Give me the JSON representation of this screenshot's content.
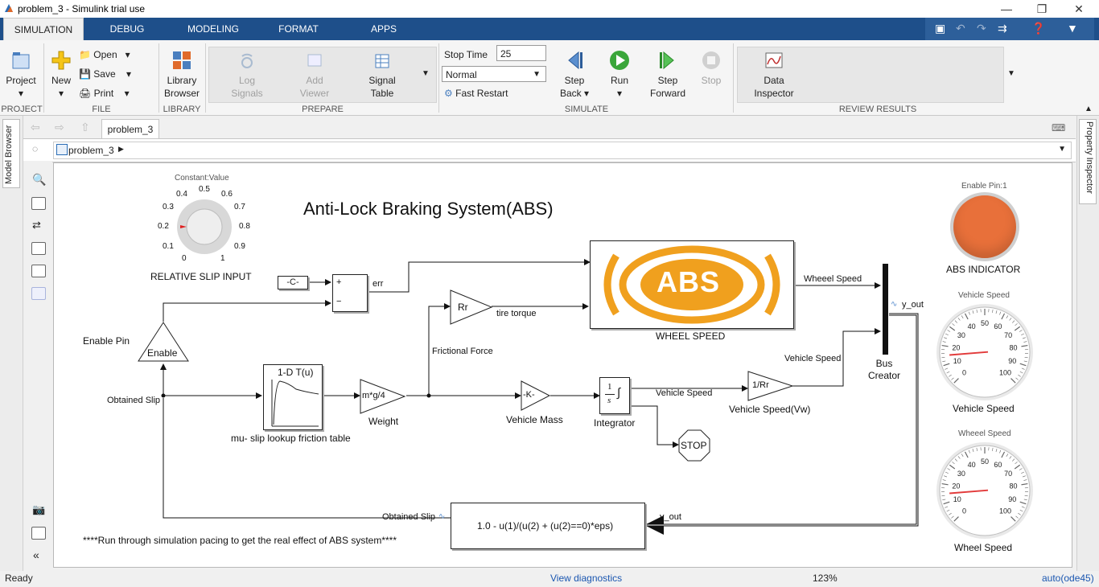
{
  "window": {
    "title": "problem_3 - Simulink trial use"
  },
  "tabs": [
    "SIMULATION",
    "DEBUG",
    "MODELING",
    "FORMAT",
    "APPS"
  ],
  "ribbon": {
    "project": "Project",
    "new": "New",
    "open": "Open",
    "save": "Save",
    "print": "Print",
    "library": "Library",
    "browser": "Browser",
    "log": "Log",
    "signals": "Signals",
    "add": "Add",
    "viewer": "Viewer",
    "signal": "Signal",
    "table": "Table",
    "stop_time_label": "Stop Time",
    "stop_time_value": "25",
    "mode": "Normal",
    "fast_restart": "Fast Restart",
    "step": "Step",
    "back": "Back",
    "run": "Run",
    "forward": "Forward",
    "stop": "Stop",
    "data": "Data",
    "inspector": "Inspector",
    "sections": {
      "project": "PROJECT",
      "file": "FILE",
      "library": "LIBRARY",
      "prepare": "PREPARE",
      "simulate": "SIMULATE",
      "review": "REVIEW RESULTS"
    }
  },
  "editor": {
    "tab": "problem_3",
    "breadcrumb": "problem_3"
  },
  "side": {
    "model_browser": "Model Browser",
    "property_inspector": "Property Inspector"
  },
  "model": {
    "title": "Anti-Lock Braking System(ABS)",
    "knob": {
      "header": "Constant:Value",
      "ticks": [
        "0.4",
        "0.5",
        "0.6",
        "0.3",
        "0.7",
        "0.2",
        "0.8",
        "0.1",
        "0.9",
        "0",
        "1"
      ],
      "label": "RELATIVE SLIP INPUT"
    },
    "const": "-C-",
    "sum_plus": "+",
    "sum_minus": "−",
    "err": "err",
    "enable": "Enable",
    "enable_pin": "Enable Pin",
    "obtained_slip": "Obtained Slip",
    "gain_rr": "Rr",
    "tire_torque": "tire torque",
    "frictional_force": "Frictional Force",
    "abs_text": "ABS",
    "wheel_speed_block": "WHEEL SPEED",
    "wheel_speed_sig": "Wheeel Speed",
    "lookup": "1-D T(u)",
    "lookup_label": "mu- slip lookup friction table",
    "weight_expr": "m*g/4",
    "weight": "Weight",
    "vehicle_mass_expr": "-K-",
    "vehicle_mass": "Vehicle Mass",
    "integ_num": "1",
    "integ_den": "s",
    "integrator": "Integrator",
    "vehicle_speed_sig": "Vehicle Speed",
    "vehicle_speed_sig2": "Vehicle Speed",
    "inv_rr": "1/Rr",
    "vehicle_speed_vw": "Vehicle Speed(Vw)",
    "stop": "STOP",
    "bus_creator": "Bus\nCreator",
    "y_out": "y_out",
    "y_out2": "y_out",
    "fcn": "1.0 - u(1)/(u(2) + (u(2)==0)*eps)",
    "obtained_slip2": "Obtained Slip",
    "note": "****Run through simulation pacing to get the real effect of ABS system****",
    "lamp_header": "Enable Pin:1",
    "lamp_label": "ABS INDICATOR",
    "gauge1": {
      "header": "Vehicle Speed",
      "label": "Vehicle Speed",
      "ticks": [
        "0",
        "10",
        "20",
        "30",
        "40",
        "50",
        "60",
        "70",
        "80",
        "90",
        "100"
      ],
      "value": 0.15
    },
    "gauge2": {
      "header": "Wheeel Speed",
      "label": "Wheel Speed",
      "ticks": [
        "0",
        "10",
        "20",
        "30",
        "40",
        "50",
        "60",
        "70",
        "80",
        "90",
        "100"
      ],
      "value": 0.15
    }
  },
  "status": {
    "ready": "Ready",
    "diagnostics": "View diagnostics",
    "zoom": "123%",
    "solver": "auto(ode45)"
  },
  "colors": {
    "ribbon_tab": "#1e4f8a",
    "abs_orange": "#f0a01e",
    "lamp": "#e8703a",
    "run_green": "#3aa63a"
  }
}
